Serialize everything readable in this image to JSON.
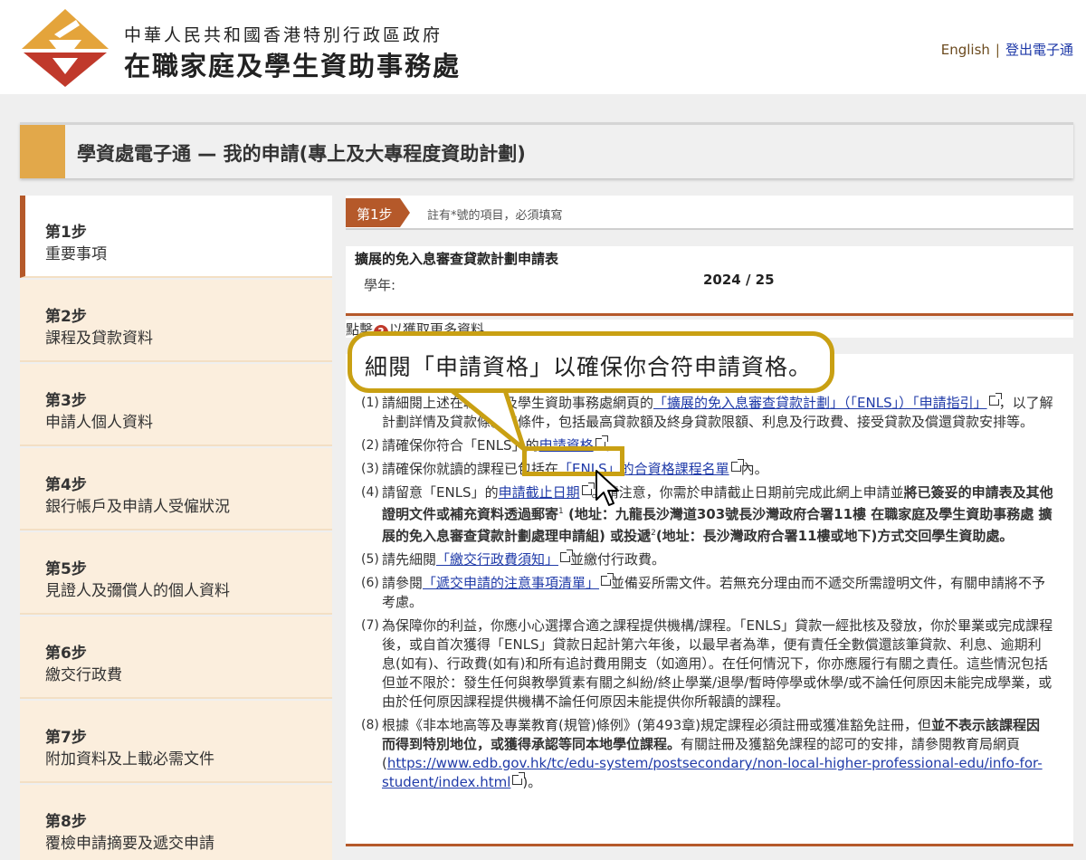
{
  "header": {
    "org_subtitle": "中華人民共和國香港特別行政區政府",
    "org_name": "在職家庭及學生資助事務處",
    "lang_link": "English",
    "separator": "|",
    "logout_link": "登出電子通"
  },
  "banner": {
    "title": "學資處電子通 — 我的申請(專上及大專程度資助計劃)"
  },
  "sidebar": {
    "steps": [
      {
        "num": "第1步",
        "label": "重要事項",
        "active": true
      },
      {
        "num": "第2步",
        "label": "課程及貸款資料"
      },
      {
        "num": "第3步",
        "label": "申請人個人資料"
      },
      {
        "num": "第4步",
        "label": "銀行帳戶及申請人受僱狀況"
      },
      {
        "num": "第5步",
        "label": "見證人及彌償人的個人資料"
      },
      {
        "num": "第6步",
        "label": "繳交行政費"
      },
      {
        "num": "第7步",
        "label": "附加資料及上載必需文件"
      },
      {
        "num": "第8步",
        "label": "覆檢申請摘要及遞交申請"
      }
    ]
  },
  "stepbar": {
    "badge": "第1步",
    "note": "註有*號的項目，必須填寫"
  },
  "form": {
    "title": "擴展的免入息審查貸款計劃申請表",
    "year_label": "學年:",
    "year_value": "2024 / 25"
  },
  "hint": {
    "before": "點擊",
    "icon": "?",
    "after": "以獲取更多資料"
  },
  "callout": {
    "text": "細閱「申請資格」以確保你合符申請資格。"
  },
  "items": {
    "i1": {
      "n": "(1)",
      "t1": "請細閱上述在職家庭及學生資助事務處網頁的",
      "link": "「擴展的免入息審查貸款計劃」（「ENLS」）「申請指引」",
      "t2": "，以了解計劃詳情及貸款條款和條件，包括最高貸款額及終身貸款限額、利息及行政費、接受貸款及償還貸款安排等。"
    },
    "i2": {
      "n": "(2)",
      "t1": "請確保你符合「ENLS」的",
      "link": "申請資格",
      "t2": "。"
    },
    "i3": {
      "n": "(3)",
      "t1": "請確保你就讀的課程已包括在",
      "link": "「ENLS」的合資格課程名單",
      "t2": "內。"
    },
    "i4": {
      "n": "(4)",
      "t1": "請留意「ENLS」的",
      "link": "申請截止日期",
      "t2": "。請注意，你需於申請截止日期前完成此網上申請並",
      "b1": "將已簽妥的申請表及其他證明文件或補充資料透過郵寄",
      "s1": "1",
      "b2": " (地址：九龍長沙灣道303號長沙灣政府合署11樓 在職家庭及學生資助事務處 擴展的免入息審查貸款計劃處理申請組) 或投遞",
      "s2": "2",
      "b3": "(地址：長沙灣政府合署11樓或地下)方式交回學生資助處。"
    },
    "i5": {
      "n": "(5)",
      "t1": "請先細閱",
      "link": "「繳交行政費須知」",
      "t2": "並繳付行政費。"
    },
    "i6": {
      "n": "(6)",
      "t1": "請參閱",
      "link": "「遞交申請的注意事項清單」",
      "t2": "並備妥所需文件。若無充分理由而不遞交所需證明文件，有關申請將不予考慮。"
    },
    "i7": {
      "n": "(7)",
      "t1": "為保障你的利益，你應小心選擇合適之課程提供機構/課程。「ENLS」貸款一經批核及發放，你於畢業或完成課程後，或自首次獲得「ENLS」貸款日起計第六年後，以最早者為準，便有責任全數償還該筆貸款、利息、逾期利息(如有)、行政費(如有)和所有追討費用開支（如適用）。在任何情況下，你亦應履行有關之責任。這些情況包括但並不限於：發生任何與教學質素有關之糾紛/終止學業/退學/暫時停學或休學/或不論任何原因未能完成學業，或由於任何原因課程提供機構不論任何原因未能提供你所報讀的課程。"
    },
    "i8": {
      "n": "(8)",
      "t1": "根據《非本地高等及專業教育(規管)條例》(第493章)規定課程必須註冊或獲准豁免註冊，但",
      "b1": "並不表示該課程因而得到特別地位，或獲得承認等同本地學位課程。",
      "t2": "有關註冊及獲豁免課程的認可的安排，請參閱教育局網頁(",
      "link": "https://www.edb.gov.hk/tc/edu-system/postsecondary/non-local-higher-professional-edu/info-for-student/index.html",
      "t3": ")。"
    }
  },
  "colors": {
    "accent": "#b5592a",
    "highlight": "#c9a013",
    "link": "#1f3aa8",
    "sidebar_bg": "#fbeedd",
    "banner_accent": "#e2a84a"
  }
}
